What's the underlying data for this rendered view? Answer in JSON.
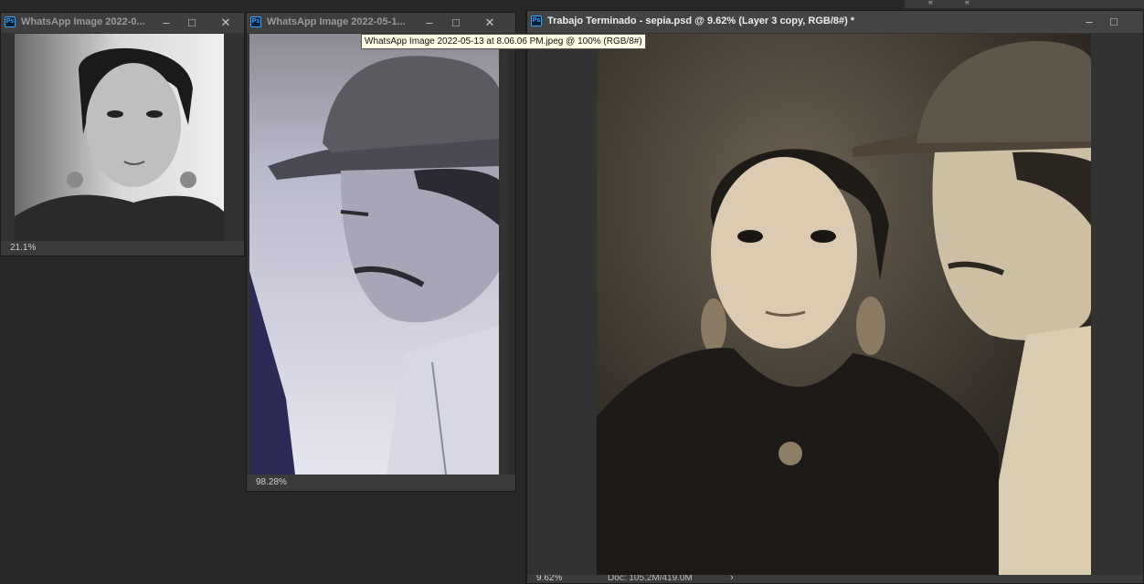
{
  "windows": {
    "doc1": {
      "title": "WhatsApp Image 2022-0...",
      "zoom": "21.1%",
      "icon": "photoshop-document-icon"
    },
    "doc2": {
      "title": "WhatsApp Image 2022-05-1...",
      "zoom": "98.28%",
      "icon": "photoshop-document-icon"
    },
    "doc3": {
      "title": "Trabajo Terminado - sepia.psd @ 9.62% (Layer 3 copy, RGB/8#) *",
      "zoom": "9.62%",
      "doc_size": "Doc: 105.2M/419.0M",
      "icon": "photoshop-document-icon"
    }
  },
  "tooltip": {
    "text": "WhatsApp Image 2022-05-13 at 8.06.06 PM.jpeg @ 100% (RGB/8#)"
  },
  "icons": {
    "ps_badge": "Ps",
    "minimize": "–",
    "maximize": "□",
    "close": "✕",
    "collapse": "«",
    "status_arrow": "›"
  }
}
